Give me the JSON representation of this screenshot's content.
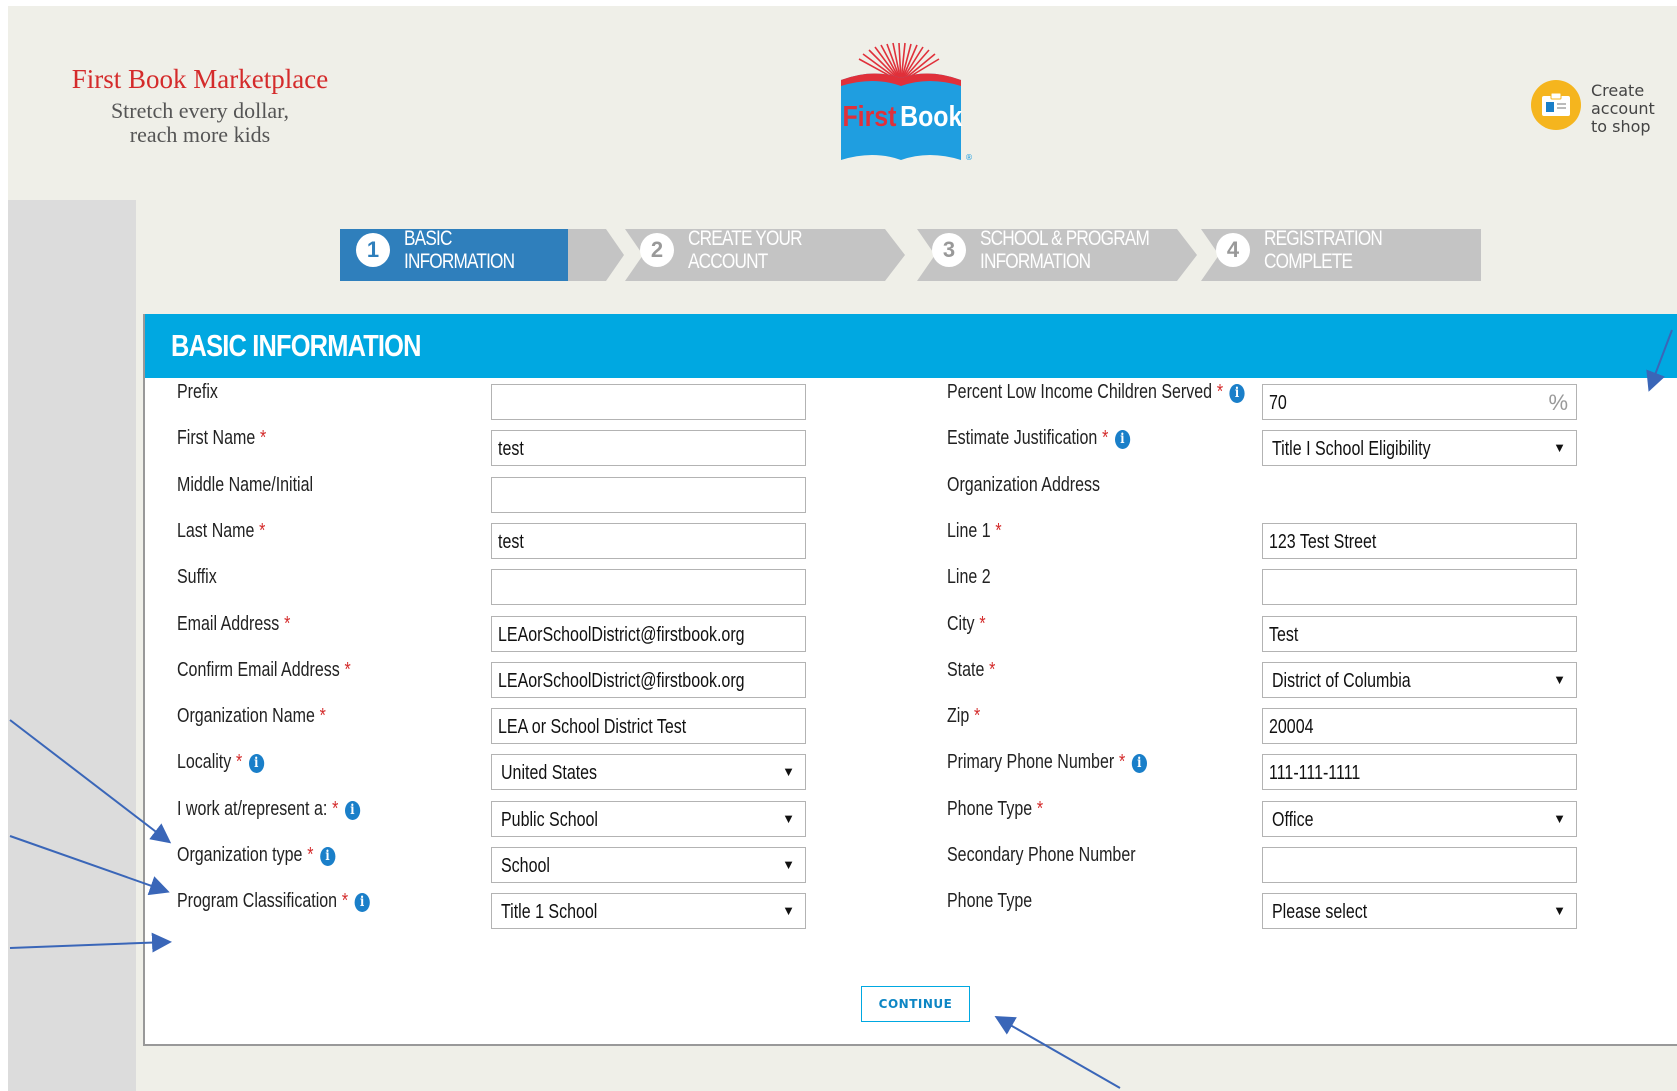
{
  "brand": {
    "title": "First Book Marketplace",
    "tagline1": "Stretch every dollar,",
    "tagline2": "reach more kids"
  },
  "logo": {
    "text_first": "First",
    "text_book": "Book",
    "mark": "®"
  },
  "account": {
    "line1": "Create",
    "line2": "account",
    "line3": "to shop",
    "icon": "id-card-icon"
  },
  "steps": [
    {
      "num": "1",
      "line1": "BASIC",
      "line2": "INFORMATION",
      "active": true
    },
    {
      "num": "2",
      "line1": "CREATE YOUR",
      "line2": "ACCOUNT",
      "active": false
    },
    {
      "num": "3",
      "line1": "SCHOOL & PROGRAM",
      "line2": "INFORMATION",
      "active": false
    },
    {
      "num": "4",
      "line1": "REGISTRATION",
      "line2": "COMPLETE",
      "active": false
    }
  ],
  "panel": {
    "title": "BASIC INFORMATION"
  },
  "left_fields": [
    {
      "label": "Prefix",
      "required": false,
      "info": false,
      "type": "text",
      "value": ""
    },
    {
      "label": "First Name",
      "required": true,
      "info": false,
      "type": "text",
      "value": "test"
    },
    {
      "label": "Middle Name/Initial",
      "required": false,
      "info": false,
      "type": "text",
      "value": ""
    },
    {
      "label": "Last Name",
      "required": true,
      "info": false,
      "type": "text",
      "value": "test"
    },
    {
      "label": "Suffix",
      "required": false,
      "info": false,
      "type": "text",
      "value": ""
    },
    {
      "label": "Email Address",
      "required": true,
      "info": false,
      "type": "text",
      "value": "LEAorSchoolDistrict@firstbook.org"
    },
    {
      "label": "Confirm Email Address",
      "required": true,
      "info": false,
      "type": "text",
      "value": "LEAorSchoolDistrict@firstbook.org"
    },
    {
      "label": "Organization Name",
      "required": true,
      "info": false,
      "type": "text",
      "value": "LEA or School District Test"
    },
    {
      "label": "Locality",
      "required": true,
      "info": true,
      "type": "select",
      "value": "United States"
    },
    {
      "label": "I work at/represent a:",
      "required": true,
      "info": true,
      "type": "select",
      "value": "Public School"
    },
    {
      "label": "Organization type",
      "required": true,
      "info": true,
      "type": "select",
      "value": "School"
    },
    {
      "label": "Program Classification",
      "required": true,
      "info": true,
      "type": "select",
      "value": "Title 1 School"
    }
  ],
  "right_fields": [
    {
      "label": "Percent Low Income Children Served",
      "required": true,
      "info": true,
      "type": "percent",
      "value": "70",
      "suffix": "%"
    },
    {
      "label": "Estimate Justification",
      "required": true,
      "info": true,
      "type": "select",
      "value": "Title I School Eligibility"
    },
    {
      "label": "Organization Address",
      "required": false,
      "info": false,
      "type": "heading",
      "value": ""
    },
    {
      "label": "Line 1",
      "required": true,
      "info": false,
      "type": "text",
      "value": "123 Test Street"
    },
    {
      "label": "Line 2",
      "required": false,
      "info": false,
      "type": "text",
      "value": ""
    },
    {
      "label": "City",
      "required": true,
      "info": false,
      "type": "text",
      "value": "Test"
    },
    {
      "label": "State",
      "required": true,
      "info": false,
      "type": "select",
      "value": "District of Columbia"
    },
    {
      "label": "Zip",
      "required": true,
      "info": false,
      "type": "text",
      "value": "20004"
    },
    {
      "label": "Primary Phone Number",
      "required": true,
      "info": true,
      "type": "text",
      "value": "111-111-1111"
    },
    {
      "label": "Phone Type",
      "required": true,
      "info": false,
      "type": "select",
      "value": "Office"
    },
    {
      "label": "Secondary Phone Number",
      "required": false,
      "info": false,
      "type": "text",
      "value": ""
    },
    {
      "label": "Phone Type",
      "required": false,
      "info": false,
      "type": "select",
      "value": "Please select"
    }
  ],
  "continue_label": "CONTINUE",
  "symbols": {
    "required": "*",
    "info": "i",
    "dropdown": "▼"
  },
  "colors": {
    "brand_red": "#d42b2b",
    "header_blue": "#00a8e1",
    "step_active": "#2f7fbc",
    "step_inactive": "#c4c4c4",
    "info_blue": "#1a7fc9",
    "accent_yellow": "#f5b51e"
  }
}
